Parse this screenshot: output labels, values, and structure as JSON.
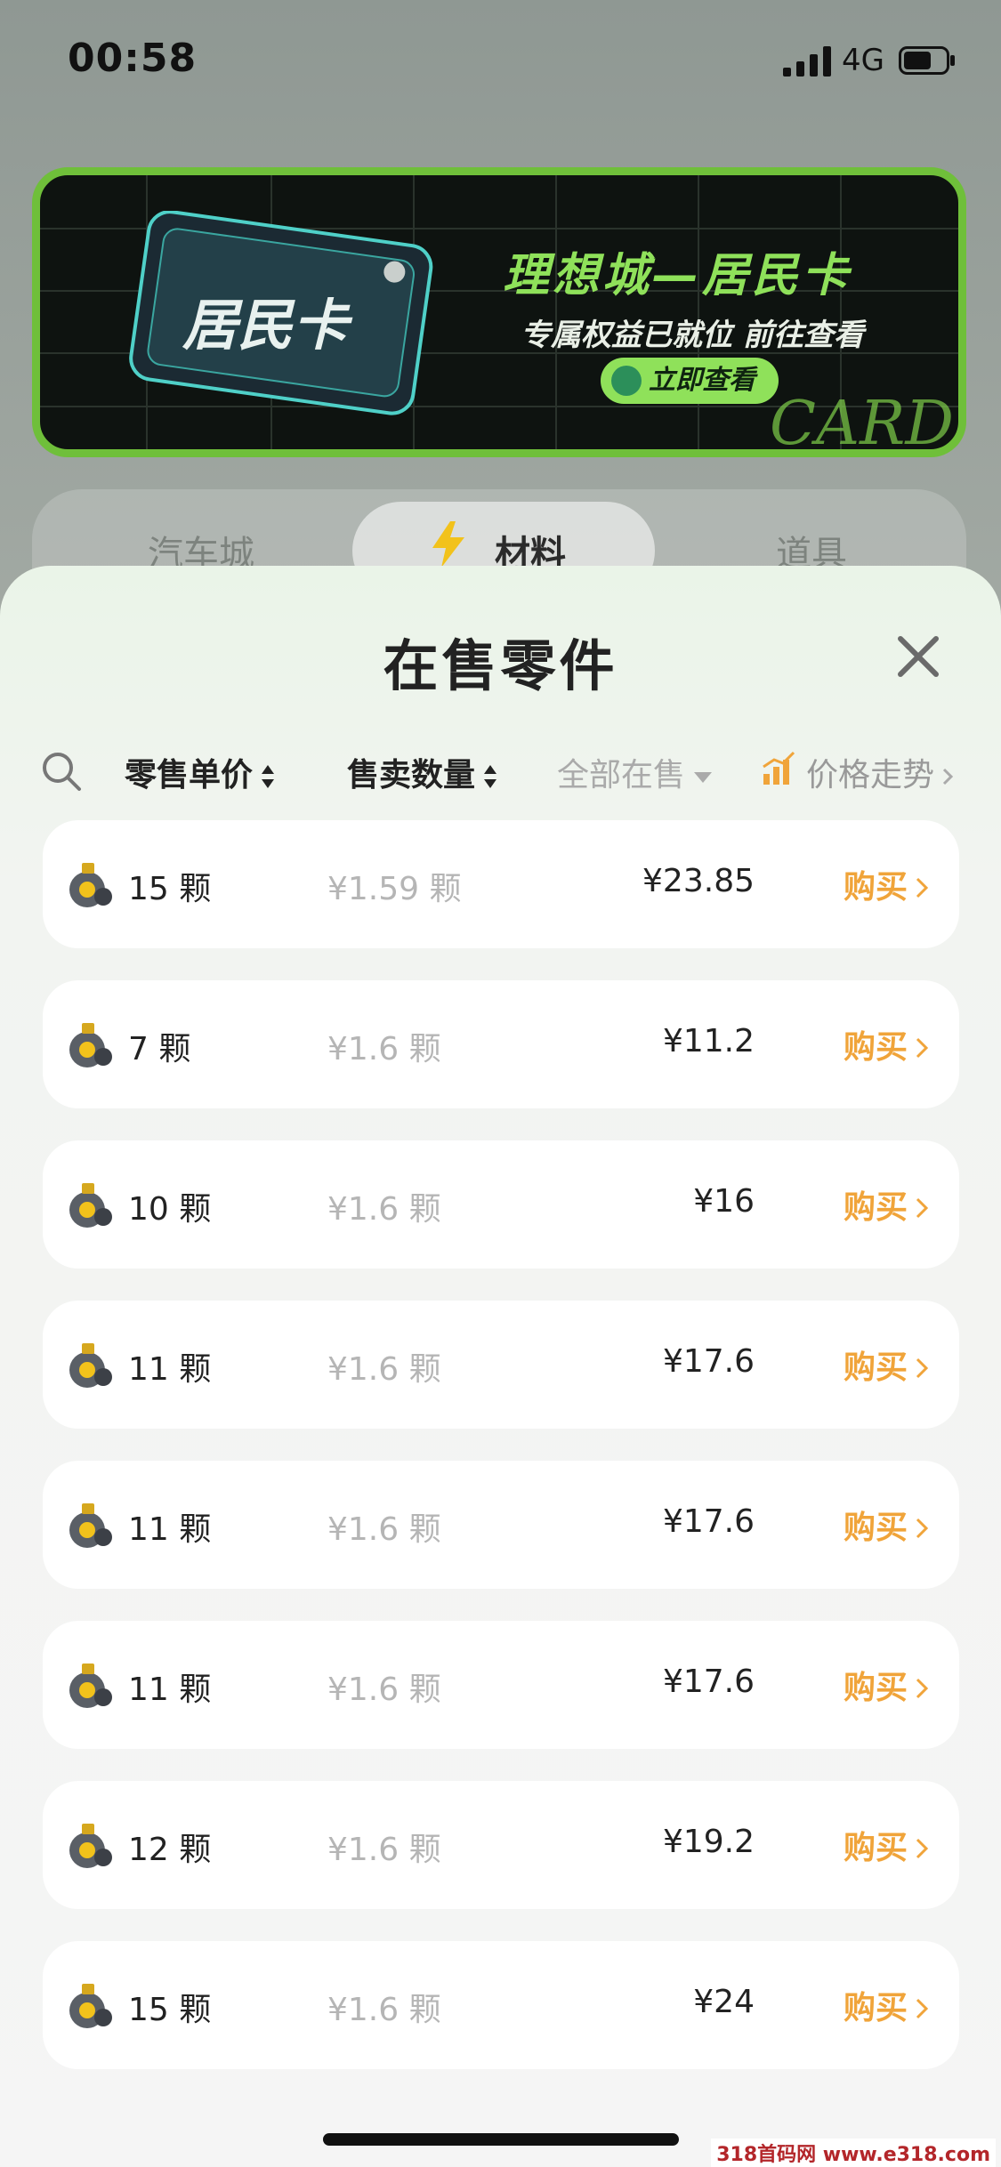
{
  "status": {
    "time": "00:58",
    "network": "4G"
  },
  "banner": {
    "card_label": "居民卡",
    "title": "理想城—居民卡",
    "subtitle": "专属权益已就位 前往查看",
    "button": "立即查看",
    "decor_text": "CARD"
  },
  "tabs": [
    {
      "label": "汽车城"
    },
    {
      "label": "材料",
      "active": true
    },
    {
      "label": "道具"
    }
  ],
  "sheet": {
    "title": "在售零件",
    "filters": {
      "unit_price": "零售单价",
      "quantity": "售卖数量",
      "status": "全部在售",
      "trend": "价格走势"
    },
    "buy_label": "购买",
    "rows": [
      {
        "qty": "15 颗",
        "unit": "¥1.59 颗",
        "total": "¥23.85"
      },
      {
        "qty": "7 颗",
        "unit": "¥1.6 颗",
        "total": "¥11.2"
      },
      {
        "qty": "10 颗",
        "unit": "¥1.6 颗",
        "total": "¥16"
      },
      {
        "qty": "11 颗",
        "unit": "¥1.6 颗",
        "total": "¥17.6"
      },
      {
        "qty": "11 颗",
        "unit": "¥1.6 颗",
        "total": "¥17.6"
      },
      {
        "qty": "11 颗",
        "unit": "¥1.6 颗",
        "total": "¥17.6"
      },
      {
        "qty": "12 颗",
        "unit": "¥1.6 颗",
        "total": "¥19.2"
      },
      {
        "qty": "15 颗",
        "unit": "¥1.6 颗",
        "total": "¥24"
      }
    ]
  },
  "watermark": "318首码网 www.e318.com",
  "colors": {
    "accent": "#f0a43a",
    "banner_green": "#8fe15a"
  }
}
